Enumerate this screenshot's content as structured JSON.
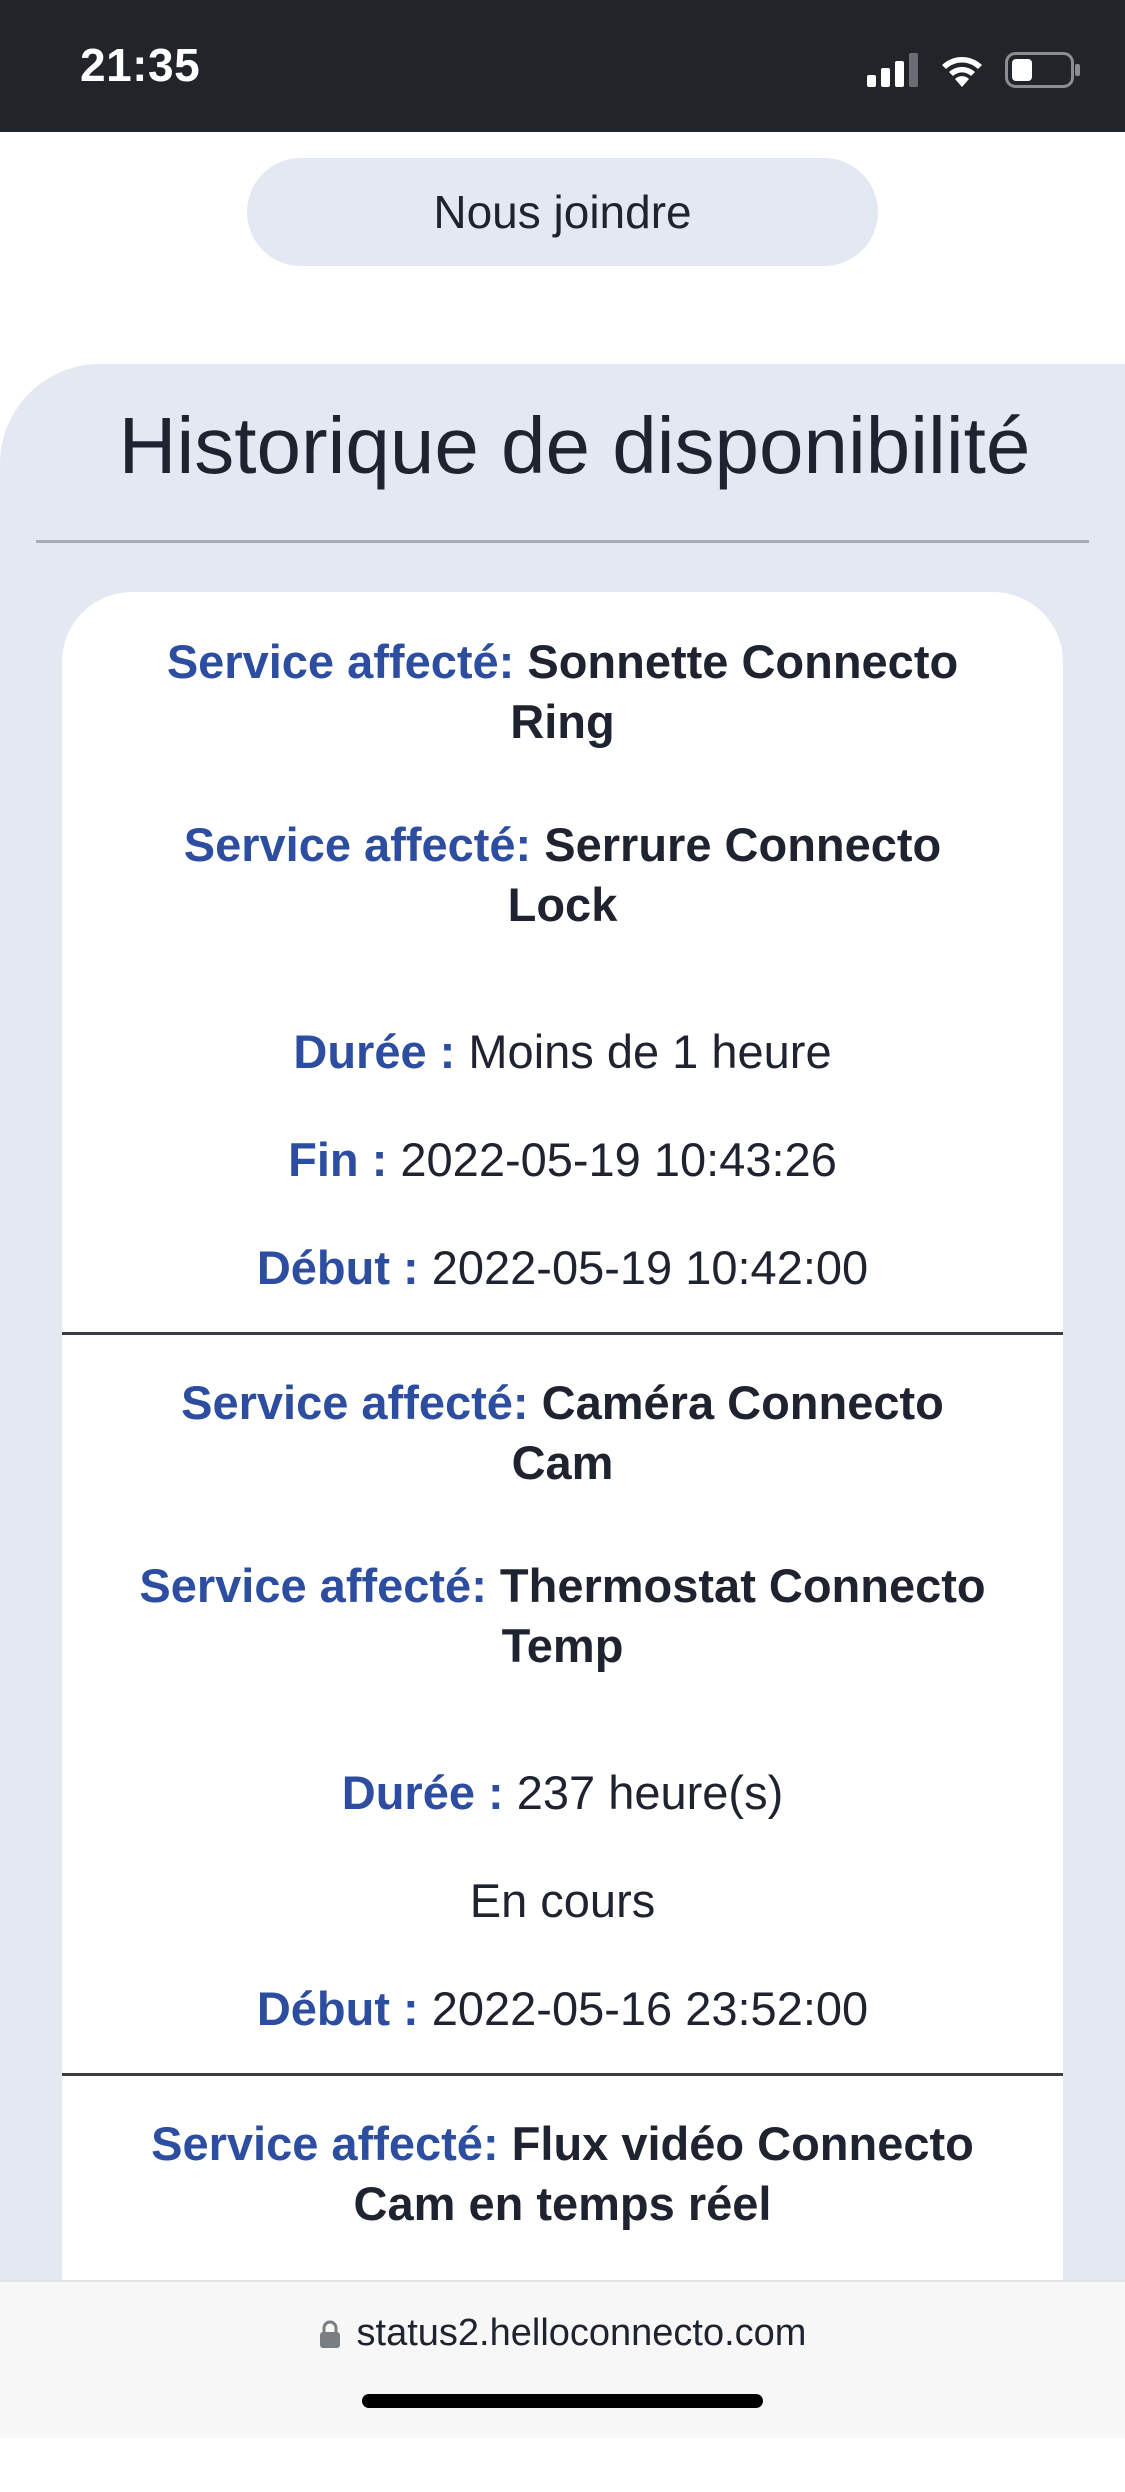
{
  "status_bar": {
    "time": "21:35"
  },
  "contact_button": {
    "label": "Nous joindre"
  },
  "history": {
    "title": "Historique de disponibilité",
    "incidents": [
      {
        "services": [
          {
            "label": "Service affecté:",
            "name": "Sonnette Connecto Ring"
          },
          {
            "label": "Service affecté:",
            "name": "Serrure Connecto Lock"
          }
        ],
        "duration_label": "Durée :",
        "duration": "Moins de 1 heure",
        "end_label": "Fin :",
        "end": "2022-05-19 10:43:26",
        "start_label": "Début :",
        "start": "2022-05-19 10:42:00"
      },
      {
        "services": [
          {
            "label": "Service affecté:",
            "name": "Caméra Connecto Cam"
          },
          {
            "label": "Service affecté:",
            "name": "Thermostat Connecto Temp"
          }
        ],
        "duration_label": "Durée :",
        "duration": "237 heure(s)",
        "status": "En cours",
        "start_label": "Début :",
        "start": "2022-05-16 23:52:00"
      },
      {
        "services": [
          {
            "label": "Service affecté:",
            "name": "Flux vidéo Connecto Cam en temps réel"
          }
        ]
      }
    ]
  },
  "browser": {
    "url": "status2.helloconnecto.com"
  },
  "colors": {
    "status_bar_bg": "#212429",
    "panel_bg": "#e3e8f2",
    "label_blue": "#2c4da0",
    "text_dark": "#1f2330"
  },
  "icons": {
    "signal": "signal-icon",
    "wifi": "wifi-icon",
    "battery": "battery-icon",
    "lock": "lock-icon"
  }
}
